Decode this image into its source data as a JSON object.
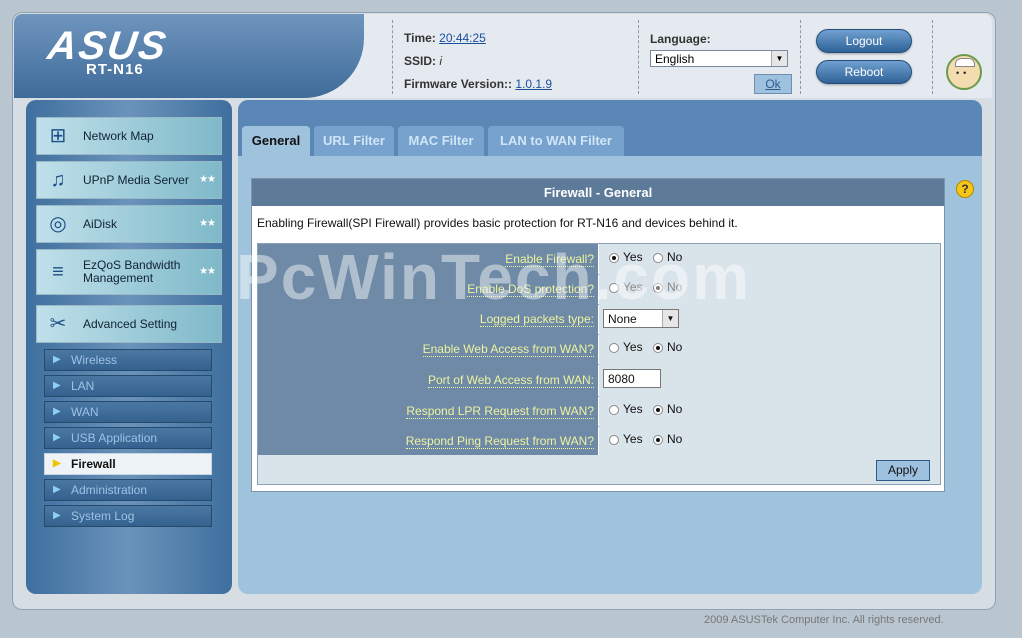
{
  "header": {
    "brand": "ASUS",
    "model": "RT-N16",
    "time_label": "Time:",
    "time_value": "20:44:25",
    "ssid_label": "SSID:",
    "ssid_value": "i",
    "firmware_label": "Firmware Version::",
    "firmware_value": "1.0.1.9",
    "language_label": "Language:",
    "language_value": "English",
    "ok_label": "Ok",
    "logout_label": "Logout",
    "reboot_label": "Reboot"
  },
  "sidebar": {
    "main_items": [
      {
        "label": "Network Map",
        "icon": "network-map-icon"
      },
      {
        "label": "UPnP Media Server",
        "icon": "media-server-icon"
      },
      {
        "label": "AiDisk",
        "icon": "aidisk-icon"
      },
      {
        "label": "EzQoS Bandwidth Management",
        "icon": "qos-icon"
      },
      {
        "label": "Advanced Setting",
        "icon": "tools-icon"
      }
    ],
    "sub_items": [
      {
        "label": "Wireless"
      },
      {
        "label": "LAN"
      },
      {
        "label": "WAN"
      },
      {
        "label": "USB Application"
      },
      {
        "label": "Firewall",
        "active": true
      },
      {
        "label": "Administration"
      },
      {
        "label": "System Log"
      }
    ]
  },
  "tabs": [
    "General",
    "URL Filter",
    "MAC Filter",
    "LAN to WAN Filter"
  ],
  "panel": {
    "title": "Firewall - General",
    "description": "Enabling Firewall(SPI Firewall) provides basic protection for RT-N16 and devices behind it.",
    "yes_label": "Yes",
    "no_label": "No",
    "rows": {
      "enable_firewall": {
        "label": "Enable Firewall?",
        "value": "Yes"
      },
      "enable_dos": {
        "label": "Enable DoS protection?",
        "value": "No"
      },
      "logged_packets": {
        "label": "Logged packets type:",
        "value": "None"
      },
      "web_access": {
        "label": "Enable Web Access from WAN?",
        "value": "No"
      },
      "web_port": {
        "label": "Port of Web Access from WAN:",
        "value": "8080"
      },
      "lpr": {
        "label": "Respond LPR Request from WAN?",
        "value": "No"
      },
      "ping": {
        "label": "Respond Ping Request from WAN?",
        "value": "No"
      }
    },
    "apply_label": "Apply"
  },
  "footer": "2009 ASUSTek Computer Inc. All rights reserved.",
  "watermark": "PcWinTech.com",
  "colors": {
    "accent": "#5b87b6",
    "label_bg": "#6e8aa6",
    "label_text": "#eef3a0"
  }
}
